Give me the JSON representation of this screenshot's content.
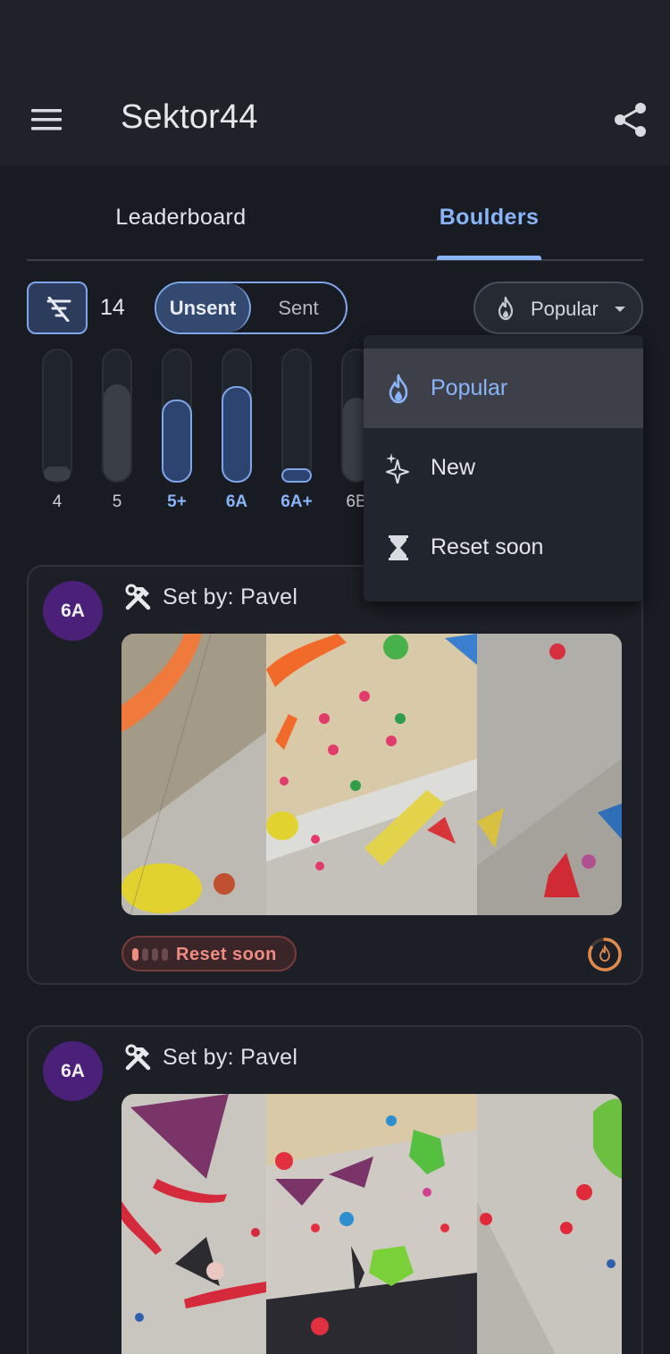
{
  "app": {
    "title": "Sektor44"
  },
  "tabs": [
    {
      "label": "Leaderboard",
      "active": false
    },
    {
      "label": "Boulders",
      "active": true
    }
  ],
  "filters": {
    "count": "14",
    "segment": {
      "unsent": "Unsent",
      "sent": "Sent",
      "selected": "Unsent"
    },
    "sort": {
      "label": "Popular"
    }
  },
  "grades": [
    {
      "label": "4",
      "level": 0.08,
      "selected": false
    },
    {
      "label": "5",
      "level": 0.74,
      "selected": false
    },
    {
      "label": "5+",
      "level": 0.64,
      "selected": true
    },
    {
      "label": "6A",
      "level": 0.74,
      "selected": true
    },
    {
      "label": "6A+",
      "level": 0.09,
      "selected": true
    },
    {
      "label": "6B",
      "level": 0.64,
      "selected": false
    }
  ],
  "sort_menu": {
    "items": [
      {
        "label": "Popular",
        "icon": "flame-icon",
        "active": true
      },
      {
        "label": "New",
        "icon": "sparkle-icon",
        "active": false
      },
      {
        "label": "Reset soon",
        "icon": "hourglass-icon",
        "active": false
      }
    ]
  },
  "boulders": [
    {
      "grade": "6A",
      "setter": "Set by: Pavel",
      "status": "Reset soon"
    },
    {
      "grade": "6A",
      "setter": "Set by: Pavel"
    }
  ],
  "colors": {
    "accent": "#8ab4f8",
    "background": "#181b22",
    "grade_badge": "#4a2078",
    "reset_text": "#f08b82"
  }
}
